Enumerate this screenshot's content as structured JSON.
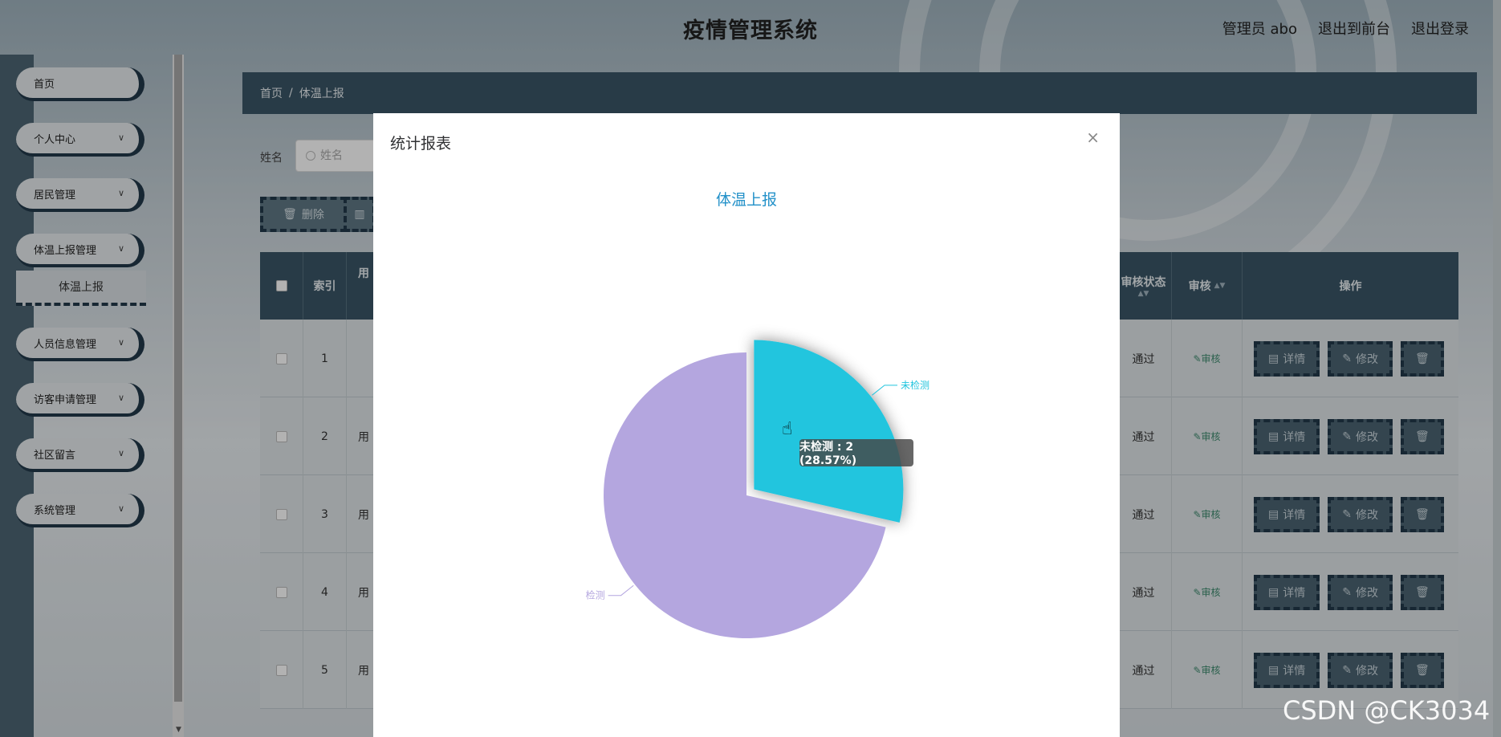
{
  "app": {
    "title": "疫情管理系统",
    "links": [
      "管理员 abo",
      "退出到前台",
      "退出登录"
    ]
  },
  "sidebar": {
    "items": [
      {
        "label": "首页",
        "has_children": false
      },
      {
        "label": "个人中心",
        "has_children": true
      },
      {
        "label": "居民管理",
        "has_children": true
      },
      {
        "label": "体温上报管理",
        "has_children": true,
        "sub": "体温上报"
      },
      {
        "label": "人员信息管理",
        "has_children": true
      },
      {
        "label": "访客申请管理",
        "has_children": true
      },
      {
        "label": "社区留言",
        "has_children": true
      },
      {
        "label": "系统管理",
        "has_children": true
      }
    ]
  },
  "breadcrumb": {
    "home": "首页",
    "sep": "/",
    "current": "体温上报"
  },
  "search": {
    "label": "姓名",
    "placeholder": "姓名"
  },
  "toolbar": {
    "delete_label": "删除"
  },
  "table": {
    "headers": {
      "index": "索引",
      "user": "用",
      "audit_status": "审核状态",
      "audit": "审核",
      "actions": "操作"
    },
    "rows": [
      {
        "index": "1",
        "user": "",
        "status": "通过"
      },
      {
        "index": "2",
        "user": "用",
        "status": "通过"
      },
      {
        "index": "3",
        "user": "用",
        "status": "通过"
      },
      {
        "index": "4",
        "user": "用",
        "status": "通过"
      },
      {
        "index": "5",
        "user": "用",
        "status": "通过"
      }
    ],
    "audit_link": "审核",
    "detail_label": "详情",
    "edit_label": "修改"
  },
  "modal": {
    "title": "统计报表",
    "close_icon": "×"
  },
  "chart_data": {
    "type": "pie",
    "title": "体温上报",
    "series": [
      {
        "name": "未检测",
        "value": 2,
        "percent": 28.57,
        "color": "#22c5de"
      },
      {
        "name": "检测",
        "value": 5,
        "percent": 71.43,
        "color": "#b4a6df"
      }
    ],
    "tooltip": "未检测 : 2 (28.57%)"
  },
  "watermark": "CSDN @CK3034"
}
